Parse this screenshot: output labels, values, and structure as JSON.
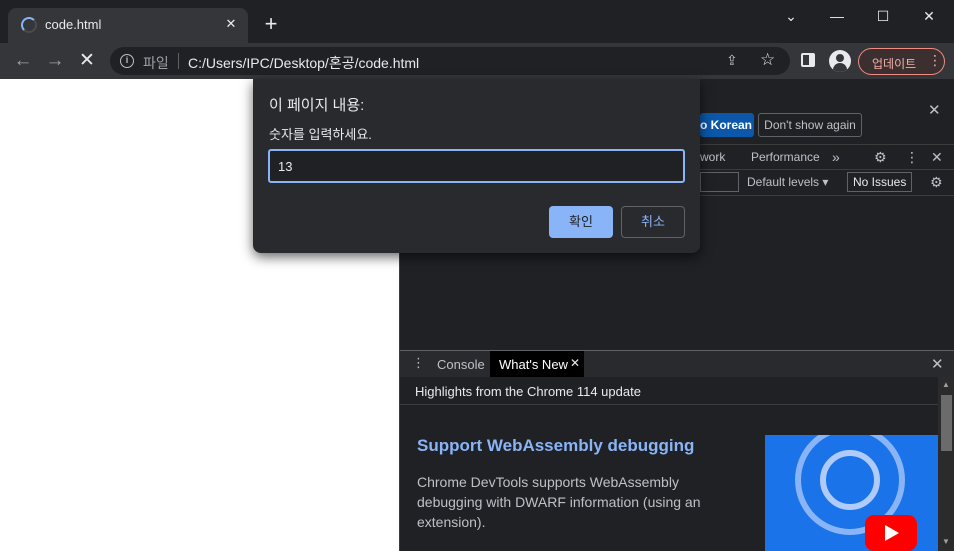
{
  "tab": {
    "title": "code.html"
  },
  "window": {
    "minimize": "—",
    "maximize": "☐",
    "close": "✕",
    "dropdown": "⌄"
  },
  "toolbar": {
    "scheme": "파일",
    "url": "C:/Users/IPC/Desktop/혼공/code.html",
    "update_label": "업데이트"
  },
  "dialog": {
    "title": "이 페이지 내용:",
    "message": "숫자를 입력하세요.",
    "input_value": "13",
    "ok_label": "확인",
    "cancel_label": "취소"
  },
  "devtools": {
    "infobar": {
      "korean_button": "o Korean",
      "dont_show_again": "Don't show again"
    },
    "tabs": [
      "work",
      "Performance"
    ],
    "filter": {
      "default_levels": "Default levels",
      "no_issues": "No Issues"
    },
    "drawer": {
      "tabs": [
        "Console",
        "What's New"
      ],
      "active_tab": "What's New"
    },
    "whats_new": {
      "header": "Highlights from the Chrome 114 update",
      "title": "Support WebAssembly debugging",
      "description": "Chrome DevTools supports WebAssembly debugging with DWARF information (using an extension)."
    }
  },
  "colors": {
    "accent": "#8ab4f8",
    "background": "#202124",
    "toolbar": "#35363a",
    "update_border": "#f28b82"
  }
}
